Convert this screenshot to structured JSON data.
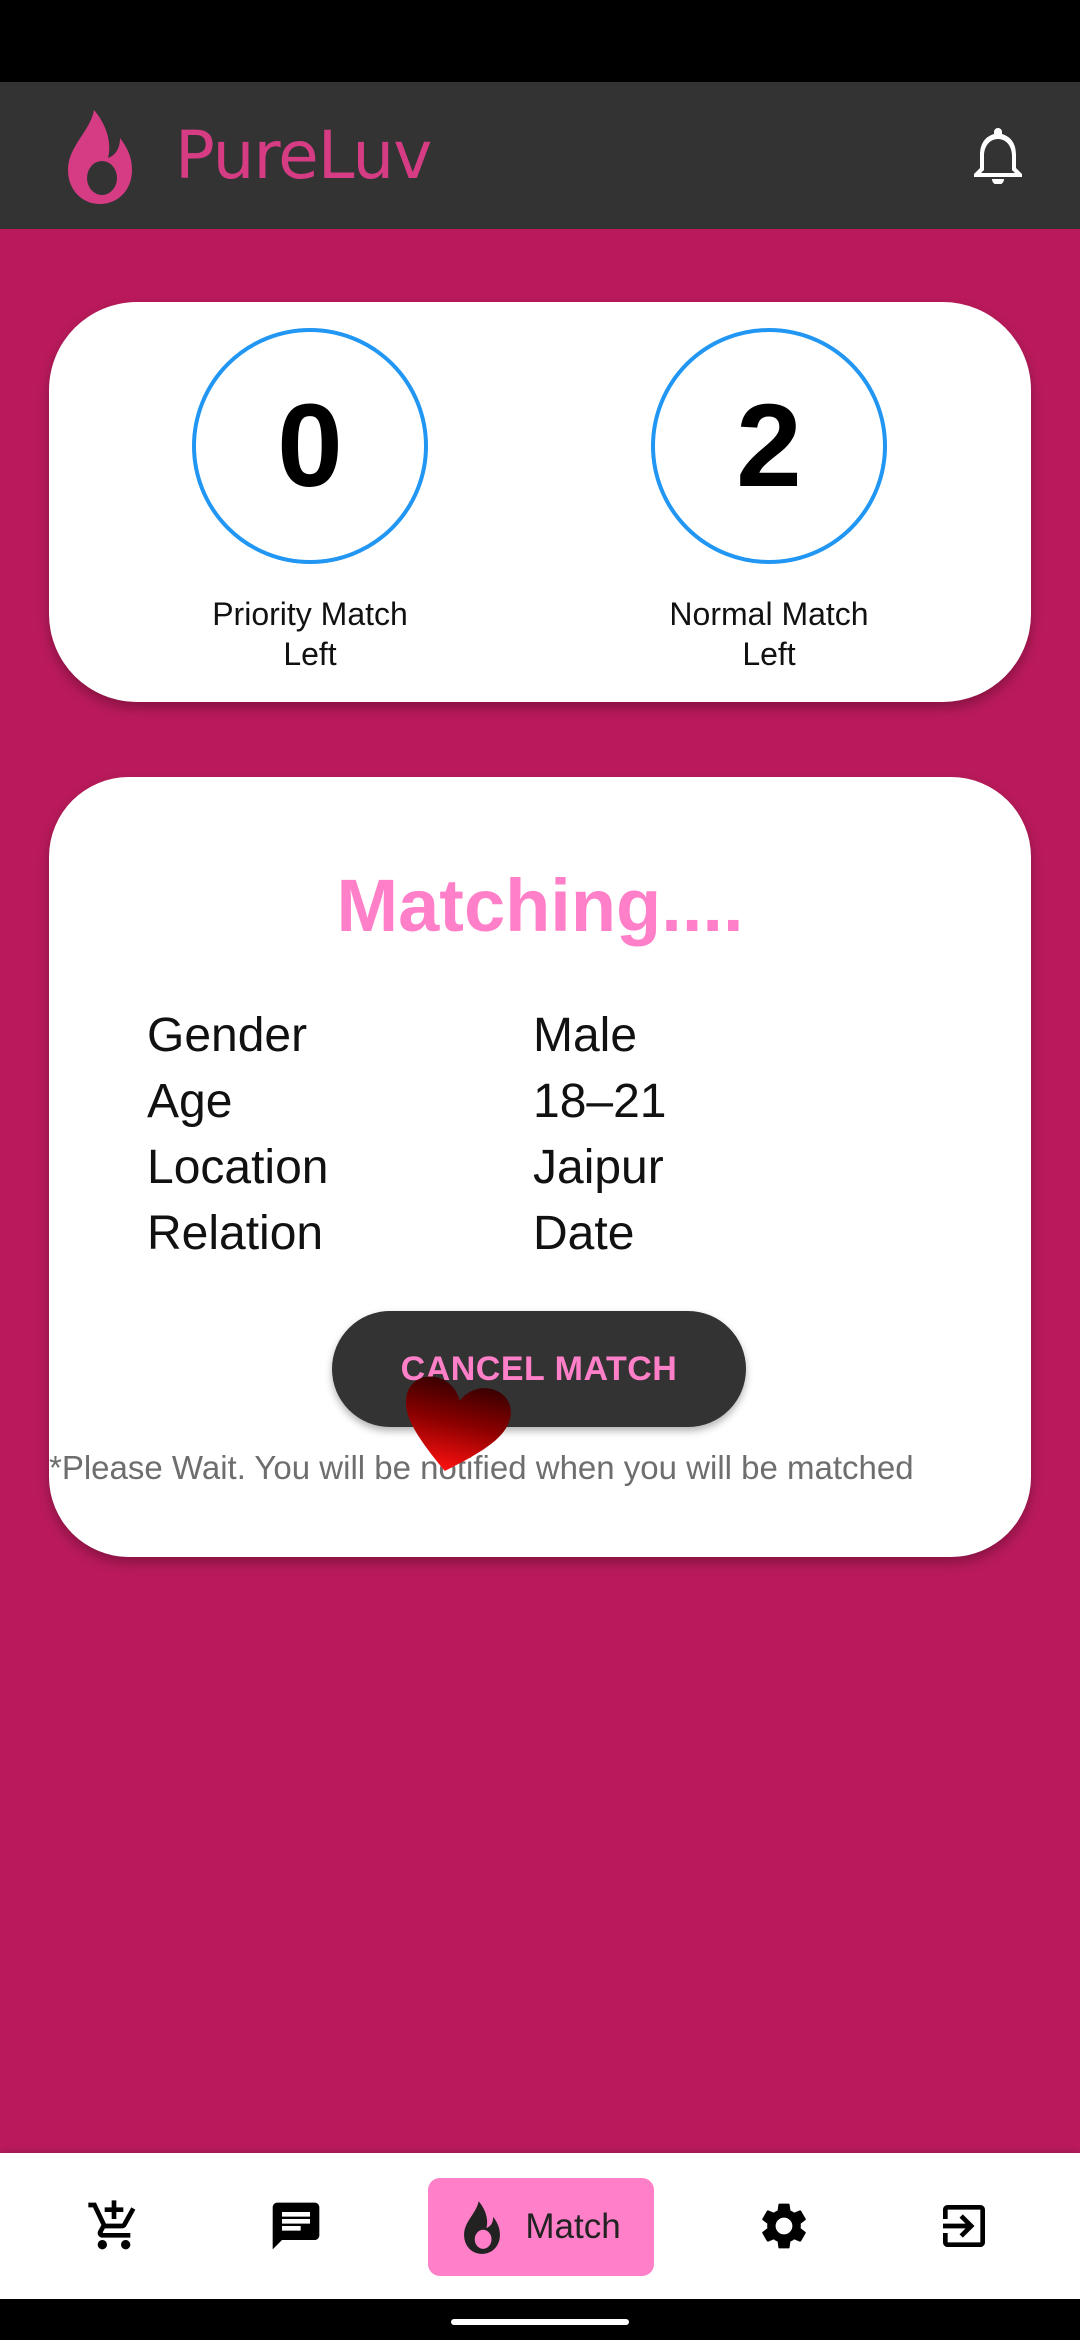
{
  "app": {
    "title": "PureLuv",
    "brand_color": "#d63c84",
    "background_color": "#ba1a5b"
  },
  "stats": {
    "priority": {
      "value": "0",
      "label_line1": "Priority Match",
      "label_line2": "Left"
    },
    "normal": {
      "value": "2",
      "label_line1": "Normal Match",
      "label_line2": "Left"
    }
  },
  "matching": {
    "title": "Matching....",
    "preferences": [
      {
        "label": "Gender",
        "value": "Male"
      },
      {
        "label": "Age",
        "value": "18–21"
      },
      {
        "label": "Location",
        "value": "Jaipur"
      },
      {
        "label": "Relation",
        "value": "Date"
      }
    ],
    "cancel_label": "CANCEL MATCH",
    "note": "*Please Wait. You will be notified when you will be matched"
  },
  "bottom_nav": {
    "items": [
      {
        "icon": "add-to-cart-icon"
      },
      {
        "icon": "chat-icon"
      },
      {
        "icon": "flame-icon",
        "label": "Match",
        "active": true
      },
      {
        "icon": "gear-icon"
      },
      {
        "icon": "logout-icon"
      }
    ]
  }
}
